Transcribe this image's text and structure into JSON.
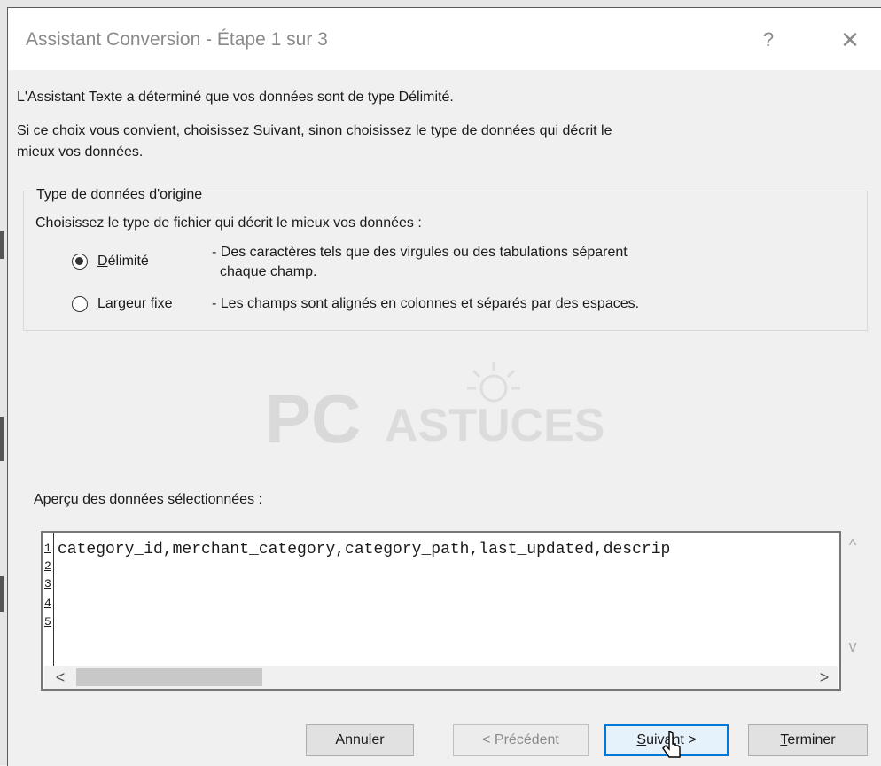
{
  "window": {
    "title": "Assistant Conversion - Étape 1 sur 3",
    "help_glyph": "?",
    "close_glyph": "✕"
  },
  "intro": {
    "line1": "L'Assistant Texte a déterminé que vos données sont de type Délimité.",
    "line2": "Si ce choix vous convient, choisissez Suivant, sinon choisissez le type de données qui décrit le",
    "line3": "mieux vos données."
  },
  "origin_type": {
    "legend": "Type de données d'origine",
    "prompt": "Choisissez le type de fichier qui décrit le mieux vos données :",
    "options": [
      {
        "label_accel": "D",
        "label_rest": "élimité",
        "desc_line1": "- Des caractères tels que des virgules ou des tabulations séparent",
        "desc_line2": "chaque champ.",
        "selected": true
      },
      {
        "label_accel": "L",
        "label_rest": "argeur fixe",
        "desc_line1": "- Les champs sont alignés en colonnes et séparés par des espaces.",
        "selected": false
      }
    ]
  },
  "watermark": {
    "brand1": "PC",
    "brand2": "ASTUCES"
  },
  "preview": {
    "label": "Aperçu des données sélectionnées :",
    "line_numbers": [
      "1",
      "2",
      "3",
      "4",
      "5"
    ],
    "rows": [
      "category_id,merchant_category,category_path,last_updated,descrip"
    ],
    "scroll_left": "<",
    "scroll_right": ">",
    "scroll_up": "^",
    "scroll_down": "v"
  },
  "buttons": {
    "cancel": "Annuler",
    "previous": "< Précédent",
    "next_accel": "S",
    "next_rest": "uivant >",
    "finish_accel": "T",
    "finish_rest": "erminer"
  },
  "colors": {
    "focus_border": "#0078d7",
    "title_text": "#8a8a8a"
  }
}
